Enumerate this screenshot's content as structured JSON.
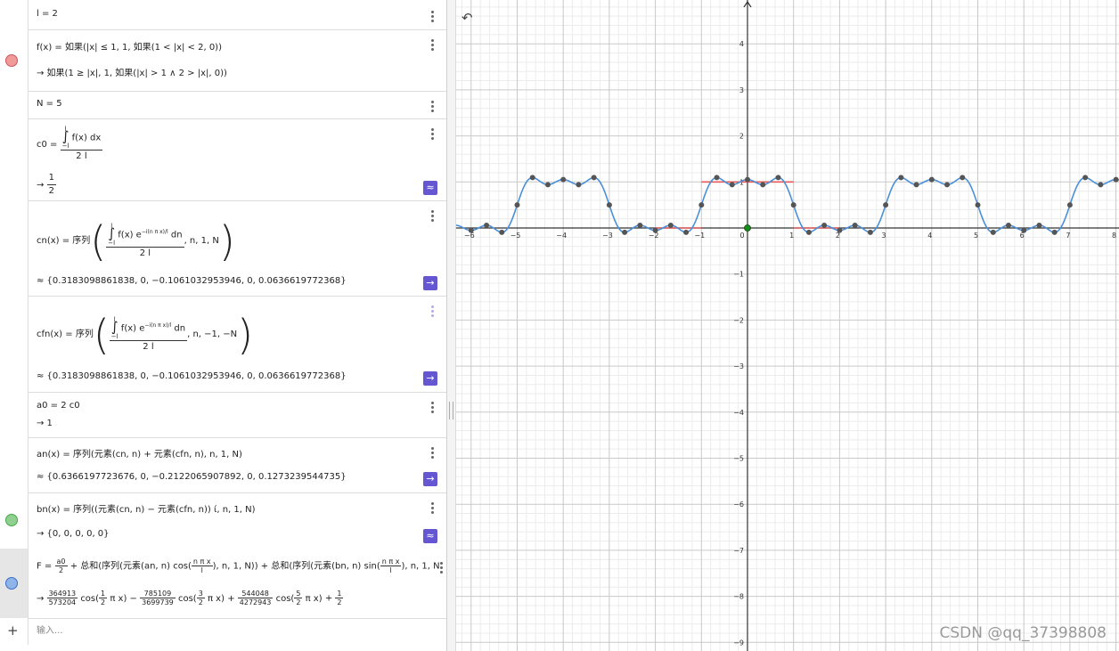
{
  "algebra": {
    "rows": [
      {
        "line1": "l = 2"
      },
      {
        "line1": "f(x) = 如果(|x| ≤ 1, 1, 如果(1 < |x| < 2, 0))",
        "line2": "→ 如果(1 ≥ |x|, 1, 如果(|x| > 1 ∧ 2 > |x|, 0))",
        "dot_color": "#f19a9a",
        "dot_border": "#c55"
      },
      {
        "line1": "N = 5"
      },
      {
        "lhs": "c0 =",
        "int_upper": "l",
        "int_lower": "−l",
        "integrand": "f(x) dx",
        "denom": "2 l",
        "res_lhs": "→",
        "res_num": "1",
        "res_den": "2",
        "button": "≈"
      },
      {
        "lhs": "cn(x) = 序列",
        "int_upper": "l",
        "int_lower": "−l",
        "integrand": "f(x) e",
        "exp": "−i(n π x)/l",
        "tail": "dn",
        "denom": "2 l",
        "args": ", n, 1, N",
        "result": "≈ {0.3183098861838, 0, −0.1061032953946, 0, 0.0636619772368}",
        "button": "→"
      },
      {
        "lhs": "cfn(x) = 序列",
        "int_upper": "l",
        "int_lower": "−l",
        "integrand": "f(x) e",
        "exp": "−i(n π x)/l",
        "tail": "dn",
        "denom": "2 l",
        "args": ", n, −1, −N",
        "result": "≈ {0.3183098861838, 0, −0.1061032953946, 0, 0.0636619772368}",
        "button": "→"
      },
      {
        "line1": "a0 = 2 c0",
        "line2": "→ 1"
      },
      {
        "line1": "an(x) = 序列(元素(cn, n) + 元素(cfn, n), n, 1, N)",
        "line2": "≈ {0.6366197723676, 0, −0.2122065907892, 0, 0.1273239544735}",
        "button": "→"
      },
      {
        "line1": "bn(x) = 序列((元素(cn, n) − 元素(cfn, n)) ί, n, 1, N)",
        "line2": "→ {0, 0, 0, 0, 0}",
        "dot_color": "#8fcf8f",
        "dot_border": "#4a4",
        "button": "≈"
      },
      {
        "line1a": "F =",
        "a0n": "a0",
        "a0d": "2",
        "line1b": "+ 总和(序列(元素(an, n) cos(",
        "arg_n": "n π x",
        "arg_d": "l",
        "line1c": "), n, 1, N)) + 总和(序列(元素(bn, n) sin(",
        "line1d": "), n, 1, N",
        "line2_terms": [
          {
            "sign": "→",
            "num": "364913",
            "den": "573204",
            "func": "cos",
            "kn": "1",
            "kd": "2",
            "rest": "π x"
          },
          {
            "sign": "−",
            "num": "785109",
            "den": "3699739",
            "func": "cos",
            "kn": "3",
            "kd": "2",
            "rest": "π x"
          },
          {
            "sign": "+",
            "num": "544048",
            "den": "4272943",
            "func": "cos",
            "kn": "5",
            "kd": "2",
            "rest": "π x"
          }
        ],
        "line2_tail_n": "1",
        "line2_tail_d": "2",
        "dot_color": "#8fb4ea",
        "dot_border": "#3a6fc4"
      }
    ],
    "input_placeholder": "输入..."
  },
  "graphics": {
    "x_ticks": [
      "−6",
      "−5",
      "−4",
      "−3",
      "−2",
      "−1",
      "0",
      "1",
      "2",
      "3",
      "4",
      "5",
      "6",
      "7",
      "8"
    ],
    "y_ticks": [
      "4",
      "3",
      "2",
      "1",
      "−1",
      "−2",
      "−3",
      "−4",
      "−5",
      "−6",
      "−7",
      "−8",
      "−9"
    ],
    "curve_color": "#4a90d9",
    "red_color": "#e85a5a",
    "point_color": "#555555",
    "origin_point_color": "#1a8a1a"
  },
  "watermark": "CSDN @qq_37398808"
}
